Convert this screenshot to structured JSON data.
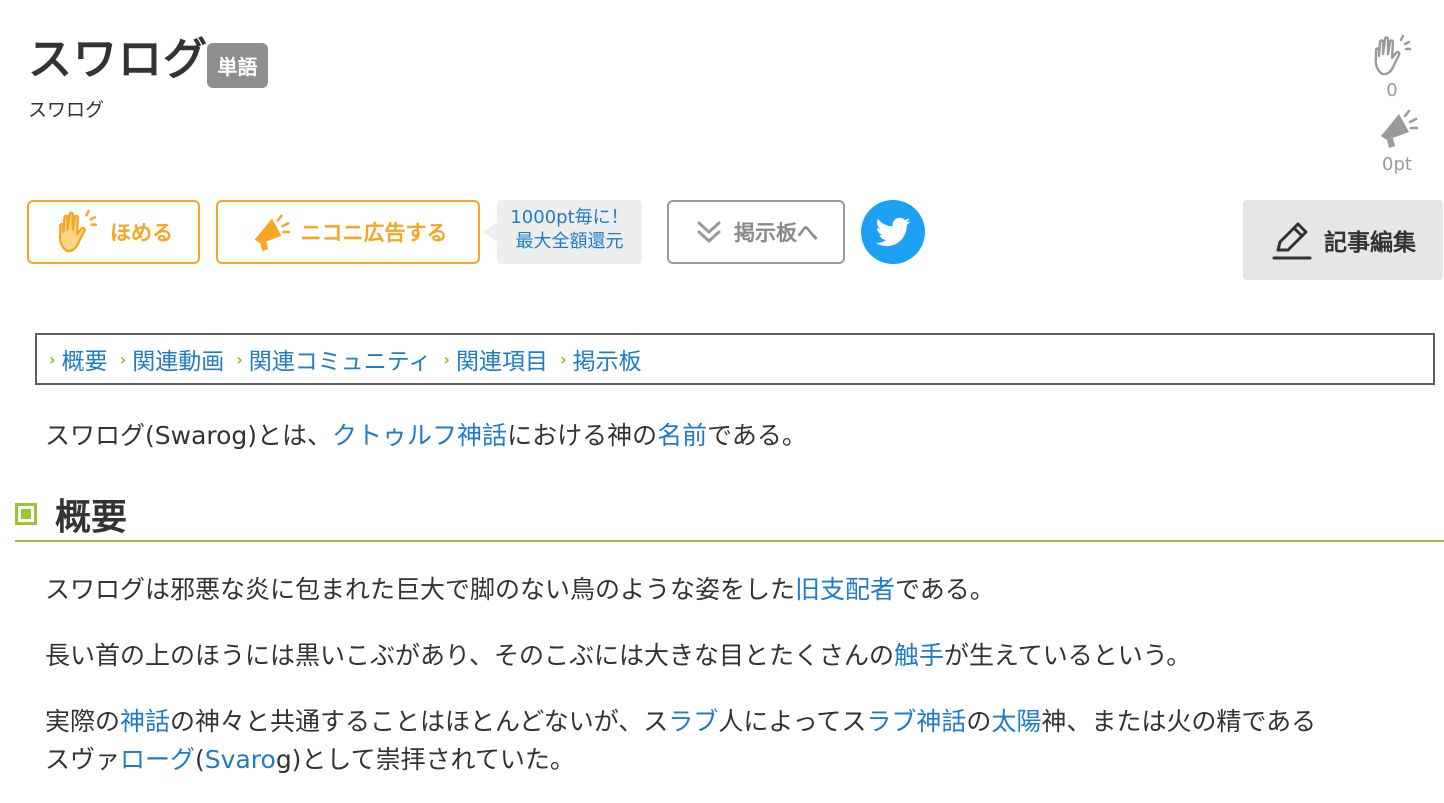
{
  "article": {
    "title": "スワログ",
    "badge": "単語",
    "reading": "スワログ"
  },
  "counters": {
    "praise_count": "0",
    "ad_points": "0pt"
  },
  "actions": {
    "praise_label": "ほめる",
    "advertise_label": "ニコニ広告する",
    "promo_line1": "1000pt毎に！",
    "promo_line2": "最大全額還元",
    "board_label": "掲示板へ",
    "edit_label": "記事編集"
  },
  "toc": [
    "概要",
    "関連動画",
    "関連コミュニティ",
    "関連項目",
    "掲示板"
  ],
  "intro": {
    "t1": "スワログ(Swarog)とは、",
    "link1": "クトゥルフ神話",
    "t2": "における神の",
    "link2": "名前",
    "t3": "である。"
  },
  "section": {
    "heading": "概要",
    "p1": {
      "t1": "スワログは邪悪な炎に包まれた巨大で脚のない鳥のような姿をした",
      "link1": "旧支配者",
      "t2": "である。"
    },
    "p2": {
      "t1": "長い首の上のほうには黒いこぶがあり、そのこぶには大きな目とたくさんの",
      "link1": "触手",
      "t2": "が生えているという。"
    },
    "p3": {
      "t1": "実際の",
      "link1": "神話",
      "t2": "の神々と共通することはほとんどないが、ス",
      "link2": "ラブ",
      "t3": "人によってス",
      "link3": "ラブ神話",
      "t4": "の",
      "link4": "太陽",
      "t5": "神、または火の精である",
      "t6": "スヴァ",
      "link5": "ローグ",
      "t7": "(",
      "link6": "Svaro",
      "t8": "g)として崇拝されていた。"
    }
  },
  "colors": {
    "accent_orange": "#f5a623",
    "link_blue": "#1f7cc7",
    "heading_green": "#9cc535",
    "twitter_blue": "#1da1f2"
  },
  "icons": [
    "clap-icon",
    "megaphone-icon",
    "double-chevron-down-icon",
    "twitter-bird-icon",
    "pencil-icon"
  ]
}
